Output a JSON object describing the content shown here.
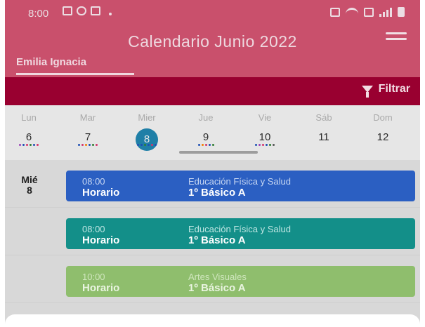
{
  "status_bar": {
    "time": "8:00"
  },
  "header": {
    "title": "Calendario Junio 2022",
    "student_tab": "Emilia Ignacia"
  },
  "filter": {
    "label": "Filtrar"
  },
  "week": {
    "days": [
      {
        "name": "Lun",
        "number": "6",
        "selected": false,
        "dots": [
          "#9a3fb7",
          "#1d4fb4",
          "#d6336c",
          "#2e7d32",
          "#1d4fb4",
          "#d6336c"
        ]
      },
      {
        "name": "Mar",
        "number": "7",
        "selected": false,
        "dots": [
          "#1d4fb4",
          "#d6336c",
          "#f57c00",
          "#1d4fb4",
          "#2e7d32",
          "#d6336c"
        ]
      },
      {
        "name": "Mier",
        "number": "8",
        "selected": true,
        "dots": [
          "#1d4fb4",
          "#1d4fb4",
          "#2e7d32",
          "#1d4fb4",
          "#d6336c",
          "#1d4fb4"
        ]
      },
      {
        "name": "Jue",
        "number": "9",
        "selected": false,
        "dots": [
          "#1d4fb4",
          "#f57c00",
          "#d6336c",
          "#1d4fb4",
          "#2e7d32"
        ]
      },
      {
        "name": "Vie",
        "number": "10",
        "selected": false,
        "dots": [
          "#1d4fb4",
          "#9a3fb7",
          "#d6336c",
          "#1d4fb4",
          "#2e7d32",
          "#555555"
        ]
      },
      {
        "name": "Sáb",
        "number": "11",
        "selected": false,
        "dots": []
      },
      {
        "name": "Dom",
        "number": "12",
        "selected": false,
        "dots": []
      }
    ]
  },
  "events": {
    "day_label": "Mié",
    "day_number": "8",
    "items": [
      {
        "time": "08:00",
        "kind": "Horario",
        "subject": "Educación Física y Salud",
        "course": "1º Básico A",
        "color": "#2b5fc2",
        "text_color": "#ffffff",
        "sub_color": "#c6d6f2"
      },
      {
        "time": "08:00",
        "kind": "Horario",
        "subject": "Educación Física y Salud",
        "course": "1º Básico A",
        "color": "#138f89",
        "text_color": "#ffffff",
        "sub_color": "#bfe6e3"
      },
      {
        "time": "10:00",
        "kind": "Horario",
        "subject": "Artes Visuales",
        "course": "1º Básico A",
        "color": "#8fbe6d",
        "text_color": "#e9f4e0",
        "sub_color": "#cfe6bd"
      }
    ]
  }
}
